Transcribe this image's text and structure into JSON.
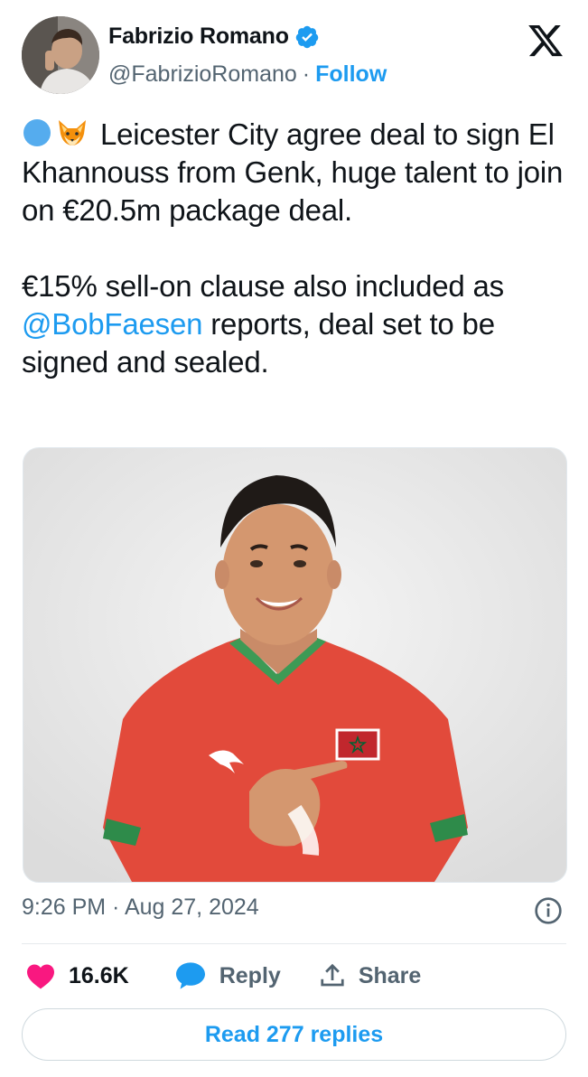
{
  "author": {
    "name": "Fabrizio Romano",
    "handle": "@FabrizioRomano",
    "separator": "·",
    "follow_label": "Follow"
  },
  "tweet": {
    "line1": "Leicester City agree deal to sign El Khannouss from Genk, huge talent to join on €20.5m package deal.",
    "line2_prefix": "€15% sell-on clause also included as ",
    "line2_mention": "@BobFaesen",
    "line2_suffix": " reports, deal set to be signed and sealed."
  },
  "meta": {
    "timestamp": "9:26 PM · Aug 27, 2024"
  },
  "actions": {
    "likes": "16.6K",
    "reply_label": "Reply",
    "share_label": "Share",
    "read_replies_label": "Read 277 replies"
  },
  "icons": {
    "like": "heart-icon",
    "reply": "speech-bubble-icon",
    "share": "share-icon",
    "info": "info-icon",
    "verified": "verified-badge-icon",
    "brand": "x-logo-icon"
  },
  "colors": {
    "accent": "#1d9bf0",
    "like": "#f91880",
    "text": "#0f1419",
    "muted": "#536471"
  }
}
